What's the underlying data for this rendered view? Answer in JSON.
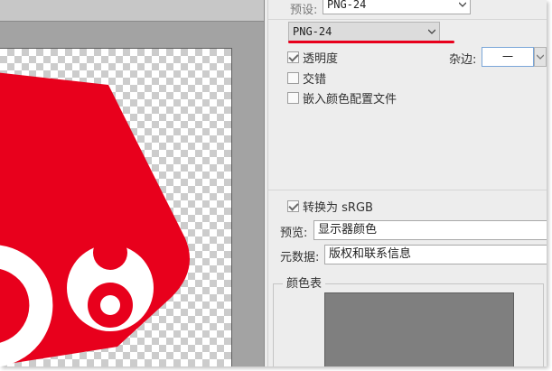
{
  "panel": {
    "preset": {
      "label": "预设:",
      "value": "PNG-24"
    },
    "format": {
      "value": "PNG-24"
    },
    "transparency": {
      "label": "透明度",
      "checked": true
    },
    "matte": {
      "label": "杂边:",
      "value": "一"
    },
    "interlaced": {
      "label": "交错",
      "checked": false
    },
    "embed_profile": {
      "label": "嵌入颜色配置文件",
      "checked": false
    },
    "convert_srgb": {
      "label": "转换为 sRGB",
      "checked": true
    },
    "preview": {
      "label": "预览:",
      "value": "显示器颜色"
    },
    "metadata": {
      "label": "元数据:",
      "value": "版权和联系信息"
    },
    "color_table": {
      "title": "颜色表"
    }
  },
  "canvas": {
    "digit": "8"
  },
  "colors": {
    "accent_red": "#e8001c",
    "checker": "#cccccc"
  }
}
